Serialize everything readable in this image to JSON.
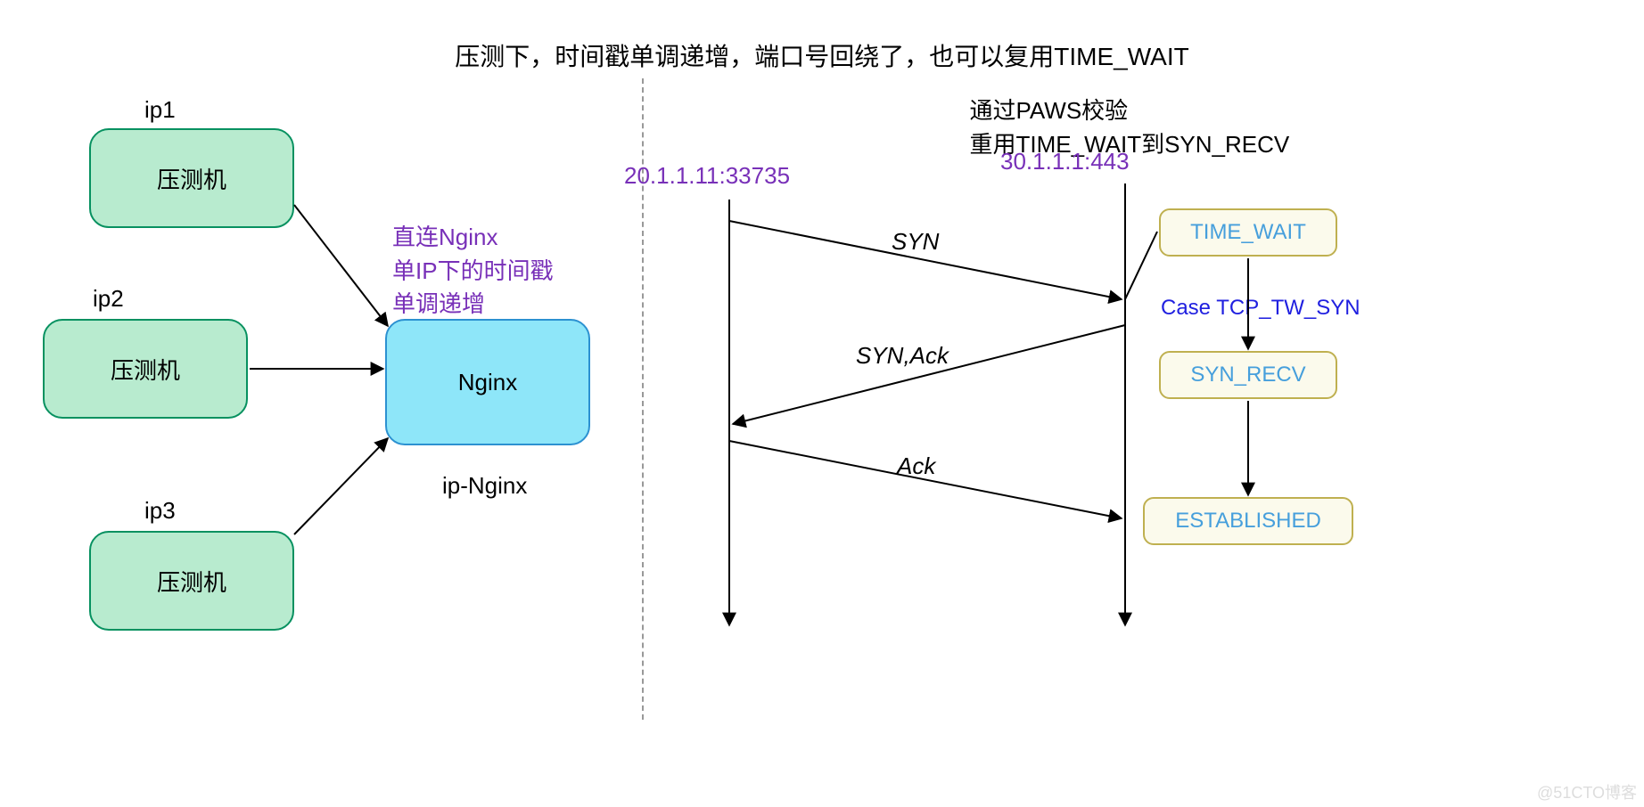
{
  "title": "压测下，时间戳单调递增，端口号回绕了，也可以复用TIME_WAIT",
  "watermark": "@51CTO博客",
  "left": {
    "clients": [
      {
        "ip": "ip1",
        "label": "压测机"
      },
      {
        "ip": "ip2",
        "label": "压测机"
      },
      {
        "ip": "ip3",
        "label": "压测机"
      }
    ],
    "nginx": {
      "label": "Nginx",
      "caption": "ip-Nginx"
    },
    "note_line1": "直连Nginx",
    "note_line2": "单IP下的时间戳",
    "note_line3": "单调递增"
  },
  "right": {
    "paws_line1": "通过PAWS校验",
    "paws_line2": "重用TIME_WAIT到SYN_RECV",
    "addr_left": "20.1.1.11:33735",
    "addr_right": "30.1.1.1:443",
    "msg1": "SYN",
    "msg2": "SYN,Ack",
    "msg3": "Ack",
    "states": {
      "s1": "TIME_WAIT",
      "s2": "SYN_RECV",
      "s3": "ESTABLISHED"
    },
    "case": "Case TCP_TW_SYN"
  }
}
